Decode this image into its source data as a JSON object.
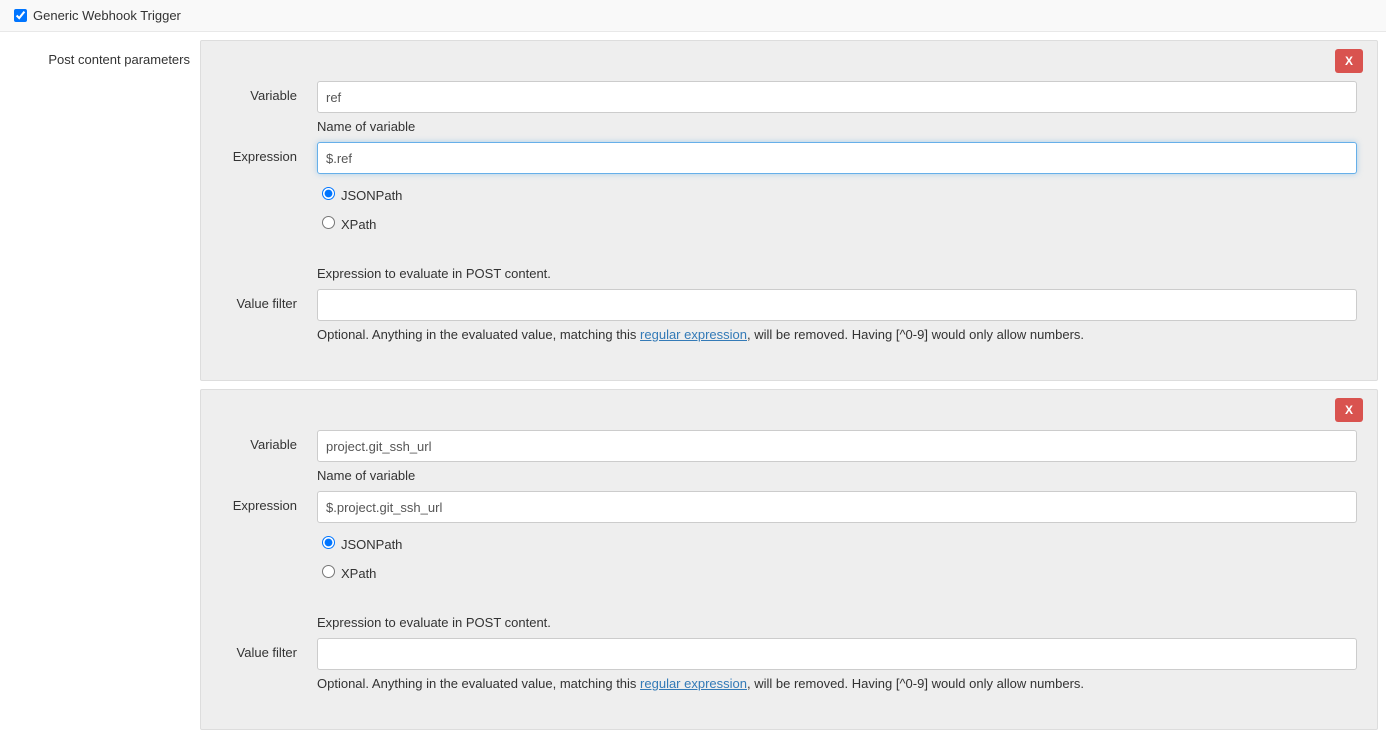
{
  "header": {
    "checkbox_checked": true,
    "title": "Generic Webhook Trigger"
  },
  "side_label": "Post content parameters",
  "labels": {
    "variable": "Variable",
    "expression": "Expression",
    "value_filter": "Value filter",
    "name_help": "Name of variable",
    "jsonpath": "JSONPath",
    "xpath": "XPath",
    "expr_help": "Expression to evaluate in POST content.",
    "value_filter_help_pre": "Optional. Anything in the evaluated value, matching this ",
    "value_filter_link": "regular expression",
    "value_filter_help_post": ", will be removed. Having [^0-9] would only allow numbers.",
    "delete": "X"
  },
  "blocks": [
    {
      "variable": "ref",
      "expression": "$.ref",
      "expression_focused": true,
      "jsonpath_selected": true,
      "value_filter": ""
    },
    {
      "variable": "project.git_ssh_url",
      "expression": "$.project.git_ssh_url",
      "expression_focused": false,
      "jsonpath_selected": true,
      "value_filter": ""
    }
  ]
}
